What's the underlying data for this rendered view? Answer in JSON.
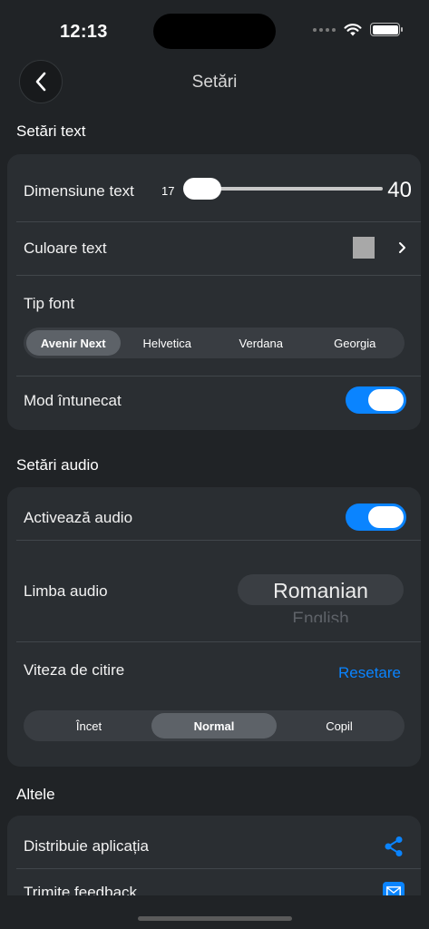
{
  "status": {
    "time": "12:13"
  },
  "nav": {
    "title": "Setări",
    "back_icon": "chevron-left-icon"
  },
  "text_settings": {
    "section_title": "Setări text",
    "text_size": {
      "label": "Dimensiune text",
      "min_label": "17",
      "value_label": "40",
      "fraction": 0.0
    },
    "text_color": {
      "label": "Culoare text",
      "swatch_color": "#a8a8a8"
    },
    "font_type": {
      "label": "Tip font",
      "options": [
        "Avenir Next",
        "Helvetica",
        "Verdana",
        "Georgia"
      ],
      "selected": "Avenir Next"
    },
    "dark_mode": {
      "label": "Mod întunecat",
      "on": true
    }
  },
  "audio_settings": {
    "section_title": "Setări audio",
    "enable_audio": {
      "label": "Activează audio",
      "on": true
    },
    "audio_language": {
      "label": "Limba audio",
      "selected": "Romanian",
      "next_option": "English"
    },
    "reading_speed": {
      "label": "Viteza de citire",
      "reset_label": "Resetare",
      "options": [
        "Încet",
        "Normal",
        "Copil"
      ],
      "selected": "Normal"
    }
  },
  "other": {
    "section_title": "Altele",
    "share_app": {
      "label": "Distribuie aplicația"
    },
    "send_feedback": {
      "label": "Trimite feedback"
    }
  },
  "colors": {
    "accent": "#0a84ff",
    "background": "#202326",
    "card": "#2a2e32"
  }
}
